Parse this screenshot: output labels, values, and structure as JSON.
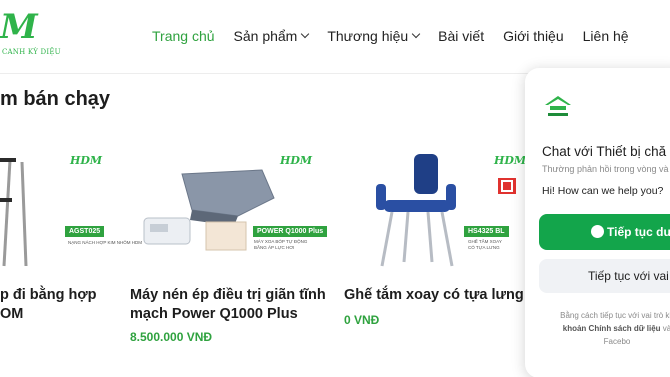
{
  "header": {
    "logo_mark": "M",
    "logo_tagline": "CANH KỲ DIỆU",
    "nav": [
      {
        "label": "Trang chủ",
        "active": true,
        "has_dropdown": false
      },
      {
        "label": "Sản phẩm",
        "active": false,
        "has_dropdown": true
      },
      {
        "label": "Thương hiệu",
        "active": false,
        "has_dropdown": true
      },
      {
        "label": "Bài viết",
        "active": false,
        "has_dropdown": false
      },
      {
        "label": "Giới thiệu",
        "active": false,
        "has_dropdown": false
      },
      {
        "label": "Liên hệ",
        "active": false,
        "has_dropdown": false
      }
    ]
  },
  "section": {
    "title": "m bán chạy"
  },
  "products": [
    {
      "name": "p đi bằng hợp\nOM",
      "price": "",
      "image": {
        "brand": "HDM",
        "tag": "AGST025",
        "note": "NẠNG NÁCH HỢP KIM NHÔM\nHDM"
      }
    },
    {
      "name": "Máy nén ép điều trị giãn tĩnh mạch Power Q1000 Plus",
      "price": "8.500.000 VNĐ",
      "image": {
        "brand": "HDM",
        "tag": "POWER Q1000 Plus",
        "note": "MÁY XOA BÓP TỰ ĐỘNG\nBẰNG ÁP LỰC HƠI"
      }
    },
    {
      "name": "Ghế tắm xoay có tựa lưng",
      "price": "0 VNĐ",
      "image": {
        "brand": "HDM",
        "tag": "HS4325 BL",
        "note": "GHẾ TẮM XOAY\nCÓ TỰA LƯNG"
      }
    }
  ],
  "chat": {
    "title": "Chat với Thiết bị chă",
    "subtitle": "Thường phản hồi trong vòng và",
    "greeting": "Hi! How can we help you?",
    "primary_button": "Tiếp tục dướ",
    "secondary_button": "Tiếp tục với vai",
    "footer_line1": "Bằng cách tiếp tục với vai trò kh",
    "footer_link1": "khoản",
    "footer_link2": "Chính sách dữ liệu",
    "footer_line2_tail": " và",
    "footer_line3": "Facebo"
  },
  "colors": {
    "brand_green": "#2fa23f",
    "chat_green": "#13a54b"
  }
}
